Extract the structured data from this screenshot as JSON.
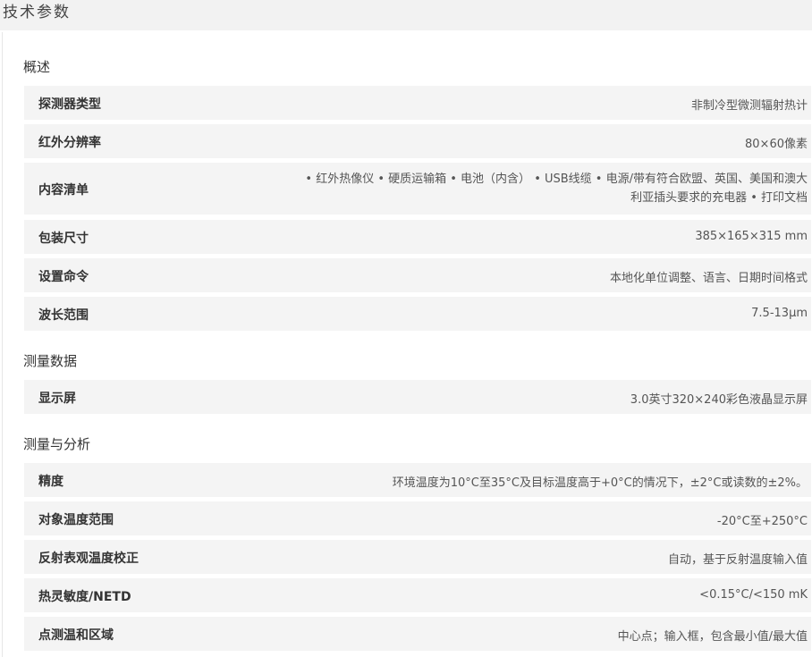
{
  "page_title": "技术参数",
  "sections": [
    {
      "title": "概述",
      "rows": [
        {
          "label": "探测器类型",
          "value": "非制冷型微测辐射热计"
        },
        {
          "label": "红外分辨率",
          "value": "80×60像素"
        },
        {
          "label": "内容清单",
          "value_line1": "• 红外热像仪 • 硬质运输箱 • 电池（内含） • USB线缆 • 电源/带有符合欧盟、英国、美国和澳大",
          "value_line2": "利亚插头要求的充电器 • 打印文档"
        },
        {
          "label": "包装尺寸",
          "value": "385×165×315 mm"
        },
        {
          "label": "设置命令",
          "value": "本地化单位调整、语言、日期时间格式"
        },
        {
          "label": "波长范围",
          "value": "7.5-13μm"
        }
      ]
    },
    {
      "title": "测量数据",
      "rows": [
        {
          "label": "显示屏",
          "value": "3.0英寸320×240彩色液晶显示屏"
        }
      ]
    },
    {
      "title": "测量与分析",
      "rows": [
        {
          "label": "精度",
          "value": "环境温度为10°C至35°C及目标温度高于+0°C的情况下，±2°C或读数的±2%。"
        },
        {
          "label": "对象温度范围",
          "value": "-20°C至+250°C"
        },
        {
          "label": "反射表观温度校正",
          "value": "自动，基于反射温度输入值"
        },
        {
          "label": "热灵敏度/NETD",
          "value": "<0.15°C/<150 mK"
        },
        {
          "label": "点测温和区域",
          "value": "中心点；输入框，包含最小值/最大值"
        }
      ]
    }
  ]
}
